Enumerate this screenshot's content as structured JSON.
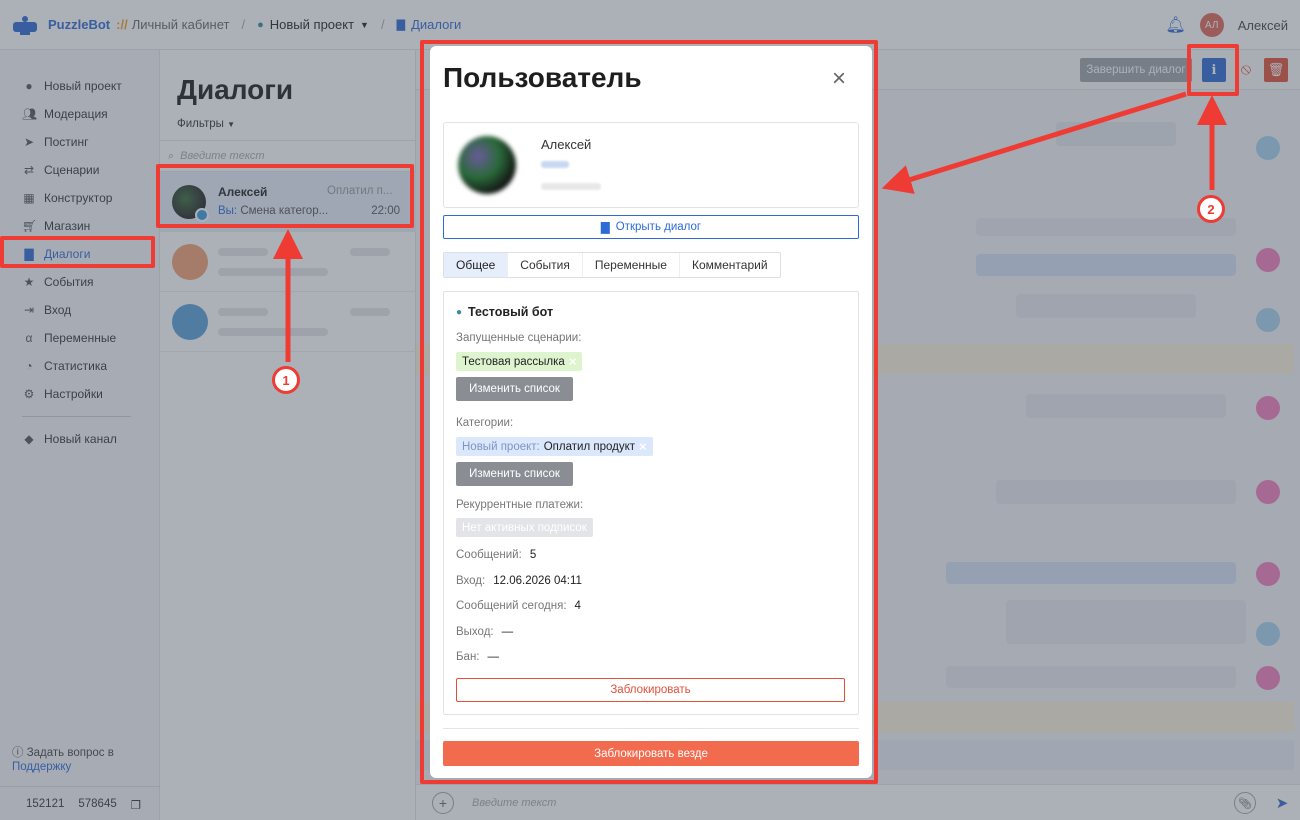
{
  "header": {
    "brand": "PuzzleBot",
    "brand_sep": "://",
    "crumb_cabinet": "Личный кабинет",
    "crumb_project": "Новый проект",
    "crumb_dialogs": "Диалоги",
    "user_initials": "АЛ",
    "user_name": "Алексей"
  },
  "sidebar": {
    "items": [
      {
        "label": "Новый проект",
        "icon": "bot-icon"
      },
      {
        "label": "Модерация",
        "icon": "users-icon"
      },
      {
        "label": "Постинг",
        "icon": "send-icon"
      },
      {
        "label": "Сценарии",
        "icon": "scenario-icon"
      },
      {
        "label": "Конструктор",
        "icon": "grid-icon"
      },
      {
        "label": "Магазин",
        "icon": "cart-icon"
      },
      {
        "label": "Диалоги",
        "icon": "chat-icon"
      },
      {
        "label": "События",
        "icon": "star-icon"
      },
      {
        "label": "Вход",
        "icon": "login-icon"
      },
      {
        "label": "Переменные",
        "icon": "variable-icon"
      },
      {
        "label": "Статистика",
        "icon": "chart-icon"
      },
      {
        "label": "Настройки",
        "icon": "gear-icon"
      }
    ],
    "new_channel": "Новый канал",
    "help_text": "Задать вопрос в",
    "help_link": "Поддержку",
    "id1": "152121",
    "id2": "578645"
  },
  "dialogs": {
    "title": "Диалоги",
    "filters": "Фильтры",
    "search_placeholder": "Введите текст",
    "selected": {
      "name": "Алексей",
      "tag": "Оплатил п...",
      "you": "Вы:",
      "message": "Смена категор...",
      "time": "22:00"
    }
  },
  "chat": {
    "finish_label": "Завершить диалог",
    "info_label": "i",
    "input_placeholder": "Введите текст"
  },
  "modal": {
    "title": "Пользователь",
    "user_name": "Алексей",
    "open_dialog": "Открыть диалог",
    "tabs": [
      "Общее",
      "События",
      "Переменные",
      "Комментарий"
    ],
    "bot_name": "Тестовый бот",
    "running_label": "Запущенные сценарии:",
    "running_chip": "Тестовая рассылка",
    "change_list": "Изменить список",
    "categories_label": "Категории:",
    "category_prefix": "Новый проект:",
    "category_value": "Оплатил продукт",
    "recurring_label": "Рекуррентные платежи:",
    "recurring_chip": "Нет активных подписок",
    "messages_label": "Сообщений:",
    "messages_value": "5",
    "login_label": "Вход:",
    "login_value": "12.06.2026 04:11",
    "today_label": "Сообщений сегодня:",
    "today_value": "4",
    "exit_label": "Выход:",
    "exit_value": "—",
    "ban_label": "Бан:",
    "ban_value": "—",
    "block_label": "Заблокировать",
    "block_all_label": "Заблокировать везде"
  },
  "annotations": {
    "badge1": "1",
    "badge2": "2"
  },
  "colors": {
    "accent": "#2d6bd6",
    "highlight": "#ee3b33",
    "danger": "#f36b4e"
  }
}
